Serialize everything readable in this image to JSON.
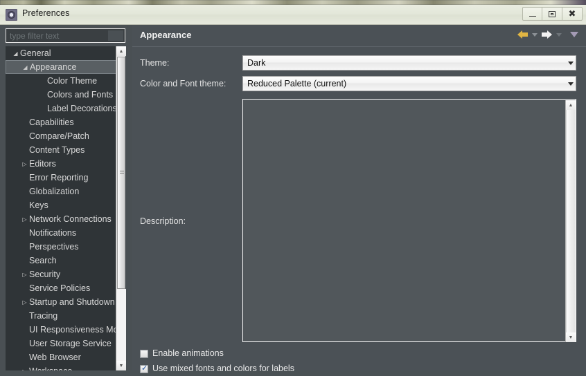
{
  "window": {
    "title": "Preferences",
    "icon": "preferences-gear-icon",
    "controls": {
      "minimize": "minimize-button",
      "maximize": "maximize-button",
      "close": "close-button"
    }
  },
  "filter": {
    "placeholder": "type filter text",
    "value": ""
  },
  "tree": {
    "items": [
      {
        "label": "General",
        "indent": 0,
        "twisty": "expanded",
        "selected": false
      },
      {
        "label": "Appearance",
        "indent": 1,
        "twisty": "expanded",
        "selected": true
      },
      {
        "label": "Color Theme",
        "indent": 2,
        "twisty": "none",
        "selected": false
      },
      {
        "label": "Colors and Fonts",
        "indent": 2,
        "twisty": "none",
        "selected": false
      },
      {
        "label": "Label Decorations",
        "indent": 2,
        "twisty": "none",
        "selected": false
      },
      {
        "label": "Capabilities",
        "indent": 1,
        "twisty": "none",
        "selected": false
      },
      {
        "label": "Compare/Patch",
        "indent": 1,
        "twisty": "none",
        "selected": false
      },
      {
        "label": "Content Types",
        "indent": 1,
        "twisty": "none",
        "selected": false
      },
      {
        "label": "Editors",
        "indent": 1,
        "twisty": "collapsed",
        "selected": false
      },
      {
        "label": "Error Reporting",
        "indent": 1,
        "twisty": "none",
        "selected": false
      },
      {
        "label": "Globalization",
        "indent": 1,
        "twisty": "none",
        "selected": false
      },
      {
        "label": "Keys",
        "indent": 1,
        "twisty": "none",
        "selected": false
      },
      {
        "label": "Network Connections",
        "indent": 1,
        "twisty": "collapsed",
        "selected": false
      },
      {
        "label": "Notifications",
        "indent": 1,
        "twisty": "none",
        "selected": false
      },
      {
        "label": "Perspectives",
        "indent": 1,
        "twisty": "none",
        "selected": false
      },
      {
        "label": "Search",
        "indent": 1,
        "twisty": "none",
        "selected": false
      },
      {
        "label": "Security",
        "indent": 1,
        "twisty": "collapsed",
        "selected": false
      },
      {
        "label": "Service Policies",
        "indent": 1,
        "twisty": "none",
        "selected": false
      },
      {
        "label": "Startup and Shutdown",
        "indent": 1,
        "twisty": "collapsed",
        "selected": false
      },
      {
        "label": "Tracing",
        "indent": 1,
        "twisty": "none",
        "selected": false
      },
      {
        "label": "UI Responsiveness Monitoring",
        "indent": 1,
        "twisty": "none",
        "selected": false
      },
      {
        "label": "User Storage Service",
        "indent": 1,
        "twisty": "none",
        "selected": false
      },
      {
        "label": "Web Browser",
        "indent": 1,
        "twisty": "none",
        "selected": false
      },
      {
        "label": "Workspace",
        "indent": 1,
        "twisty": "collapsed",
        "selected": false
      }
    ]
  },
  "page": {
    "title": "Appearance",
    "nav": {
      "back": "back-arrow",
      "back_menu": "back-dropdown",
      "forward": "forward-arrow",
      "forward_menu": "forward-dropdown",
      "view_menu": "view-menu"
    },
    "theme": {
      "label": "Theme:",
      "value": "Dark"
    },
    "color_font_theme": {
      "label": "Color and Font theme:",
      "value": "Reduced Palette (current)"
    },
    "description": {
      "label": "Description:",
      "value": ""
    },
    "checkboxes": [
      {
        "label": "Enable animations",
        "checked": false
      },
      {
        "label": "Use mixed fonts and colors for labels",
        "checked": true
      }
    ]
  },
  "colors": {
    "window_bg": "#4a5054",
    "panel_bg": "#4b5156",
    "tree_bg": "#2f3437",
    "selection_bg": "#595f63",
    "text": "#e4e4e4",
    "accent_back_arrow": "#e0b543",
    "accent_forward_arrow": "#f2f2f2",
    "titlebar": "#e4e8da"
  }
}
